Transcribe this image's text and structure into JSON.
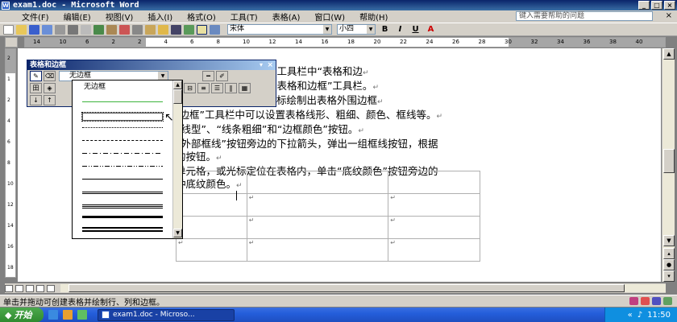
{
  "window": {
    "title": "exam1.doc - Microsoft Word"
  },
  "menu": {
    "items": [
      "文件(F)",
      "编辑(E)",
      "视图(V)",
      "插入(I)",
      "格式(O)",
      "工具(T)",
      "表格(A)",
      "窗口(W)",
      "帮助(H)"
    ],
    "ask_placeholder": "键入需要帮助的问题"
  },
  "toolbar": {
    "font": "宋体",
    "size": "小四",
    "bold": "B",
    "italic": "I",
    "underline": "U"
  },
  "ruler": {
    "numbers": [
      "14",
      "10",
      "6",
      "2",
      "2",
      "4",
      "6",
      "8",
      "10",
      "12",
      "14",
      "16",
      "18",
      "20",
      "22",
      "24",
      "26",
      "28",
      "30",
      "32",
      "34",
      "36",
      "38",
      "40"
    ]
  },
  "vruler": {
    "numbers": [
      "2",
      "1",
      "2",
      "4",
      "6",
      "8",
      "10",
      "12",
      "14",
      "16",
      "18"
    ]
  },
  "document": {
    "lines": [
      "绘制表格。单击“常用”工具栏中“表格和边",
      "绘制表格”命令，弹出“表格和边框”工具栏。",
      "以按住鼠标左键拖动鼠标绘制出表格外围边框",
      "和边框”工具栏中可以设置表格线形、粗细、颜色、框线等。",
      "“线型”、“线条粗细”和“边框颜色”按钮。",
      "“外部框线”按钮旁边的下拉箭头，弹出一组框线按钮，根据",
      "的按钮。",
      "单元格，或光标定位在表格内，单击“底纹颜色”按钮旁边的",
      "种底纹颜色。"
    ],
    "para_mark": "↵"
  },
  "floating_toolbar": {
    "title": "表格和边框",
    "line_style": "无边框",
    "close": "×",
    "menu": "▾"
  },
  "dropdown": {
    "selected": "无边框"
  },
  "status": {
    "text": "单击并拖动可创建表格并绘制行、列和边框。"
  },
  "taskbar": {
    "start": "开始",
    "task": "exam1.doc - Microso...",
    "clock": "11:50"
  }
}
